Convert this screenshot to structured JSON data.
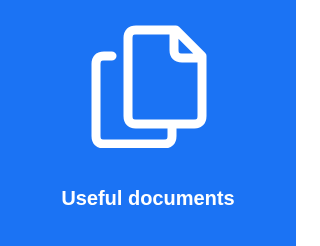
{
  "tile": {
    "label": "Useful documents",
    "icon": "documents-copy-icon",
    "background_color": "#1B73F4",
    "foreground_color": "#FFFFFF"
  }
}
